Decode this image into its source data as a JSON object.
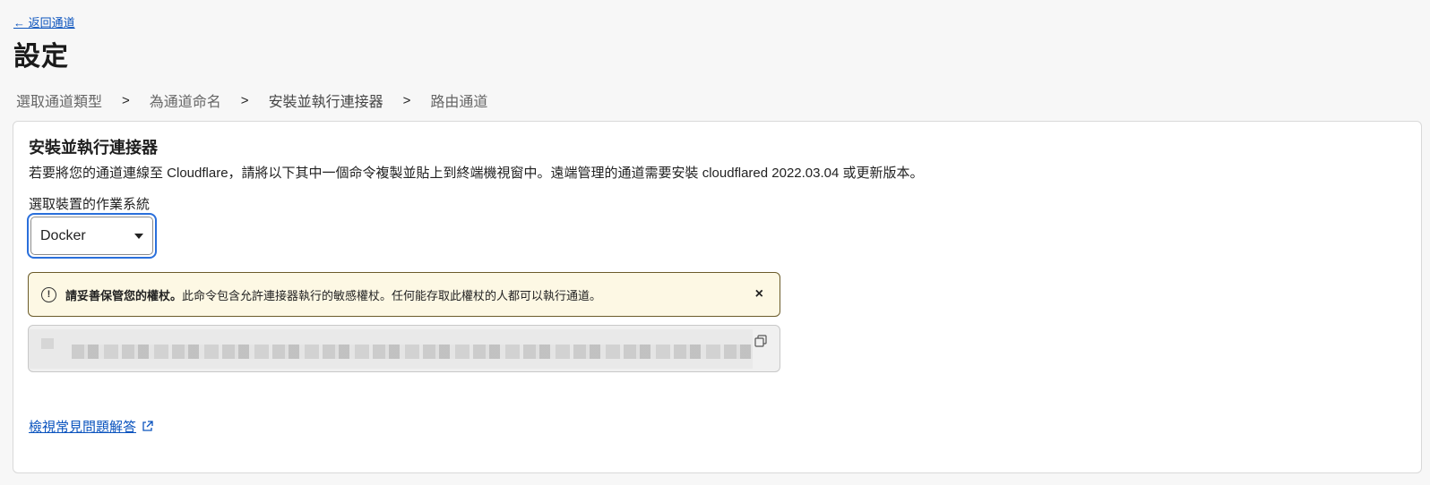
{
  "nav": {
    "back_label": "← 返回通道",
    "page_title": "設定"
  },
  "steps": [
    {
      "label": "選取通道類型"
    },
    {
      "label": "為通道命名"
    },
    {
      "label": "安裝並執行連接器"
    },
    {
      "label": "路由通道"
    }
  ],
  "step_separator": ">",
  "card": {
    "title": "安裝並執行連接器",
    "description": "若要將您的通道連線至 Cloudflare，請將以下其中一個命令複製並貼上到終端機視窗中。遠端管理的通道需要安裝 cloudflared 2022.03.04 或更新版本。",
    "os_label": "選取裝置的作業系統",
    "os_selected": "Docker"
  },
  "warning": {
    "icon": "exclamation-circle-icon",
    "bold_text": "請妥善保管您的權杖。",
    "text": "此命令包含允許連接器執行的敏感權杖。任何能存取此權杖的人都可以執行通道。",
    "close_symbol": "×"
  },
  "command_box": {
    "icon": "copy-icon"
  },
  "faq": {
    "link_label": "檢視常見問題解答",
    "icon": "external-link-icon"
  },
  "colors": {
    "link": "#0a53be",
    "focus_ring": "#2a6fdb",
    "warning_bg": "#fdf8e4",
    "warning_border": "#6b5b2a"
  }
}
